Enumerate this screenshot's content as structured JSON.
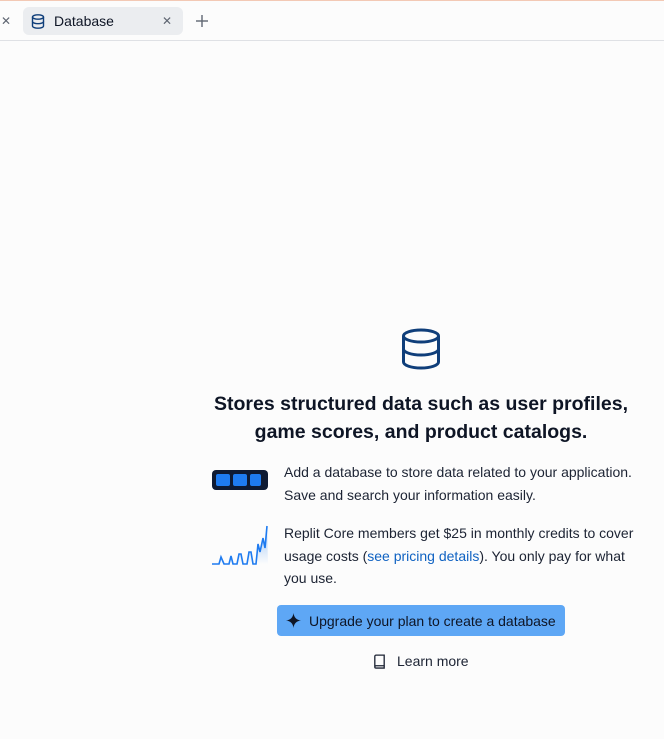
{
  "tabs": [
    {
      "label": "Database",
      "icon": "database-icon",
      "active": true
    }
  ],
  "empty_state": {
    "icon": "database-icon",
    "headline": "Stores structured data such as user profiles, game scores, and product catalogs.",
    "features": [
      {
        "icon": "battery-storage-icon",
        "text": "Add a database to store data related to your application. Save and search your information easily."
      },
      {
        "icon": "usage-chart-icon",
        "text_before": "Replit Core members get $25 in monthly credits to cover usage costs (",
        "link": "see pricing details",
        "text_after": "). You only pay for what you use."
      }
    ],
    "upgrade_button": "Upgrade your plan to create a database",
    "learn_more": "Learn more"
  },
  "colors": {
    "accent_button": "#5ea7f5",
    "link": "#0f62c2",
    "icon_blue": "#0f3e7a",
    "tab_active_bg": "#ebedf0"
  }
}
